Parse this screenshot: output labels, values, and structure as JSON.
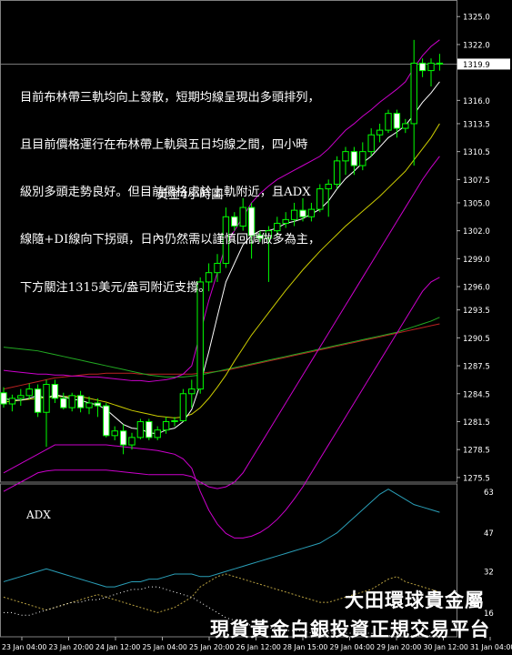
{
  "comment_lines": [
    "目前布林帶三軌均向上發散，短期均線呈現出多頭排列，",
    "且目前價格運行在布林帶上軌與五日均線之間，四小時",
    "級別多頭走勢良好。但目前價格處於上軌附近，且ADX",
    "線隨+DI線向下拐頭，日內仍然需以謹慎回調做多為主，",
    "下方關注1315美元/盎司附近支撐。"
  ],
  "chart_title": "黃金4小時圖",
  "adx_label": "ADX",
  "brand": {
    "line1": "大田環球貴金屬",
    "line2": "現貨黃金白銀投資正規交易平台"
  },
  "colors": {
    "bull_body": "#000000",
    "bear_body": "#ffffff",
    "candle_outline": "#00ff00",
    "bollinger": "#cc00cc",
    "ma_white": "#ffffff",
    "ma_yellow": "#cccc00",
    "ma_green": "#22aa22",
    "ma_red": "#bb2222",
    "adx_line": "#2a9fb8",
    "di_plus": "#b8a040",
    "di_minus": "#ffffff"
  },
  "chart_data": {
    "type": "candlestick",
    "title": "黃金4小時圖",
    "price_axis": {
      "ticks": [
        1325.0,
        1322.0,
        1319.9,
        1316.0,
        1313.5,
        1310.5,
        1307.5,
        1305.0,
        1302.0,
        1299.0,
        1296.0,
        1293.5,
        1290.5,
        1287.5,
        1284.5,
        1281.5,
        1278.5,
        1275.5
      ],
      "current_price_label": "1319.9",
      "range": [
        1275,
        1326
      ]
    },
    "time_axis": {
      "ticks": [
        "23 Jan 04:00",
        "23 Jan 20:00",
        "24 Jan 12:00",
        "25 Jan 04:00",
        "25 Jan 20:00",
        "26 Jan 12:00",
        "28 Jan 15:00",
        "29 Jan 04:00",
        "29 Jan 20:00",
        "30 Jan 12:00",
        "31 Jan 04:00"
      ]
    },
    "candles": [
      {
        "o": 1284.6,
        "h": 1285.2,
        "l": 1283.0,
        "c": 1283.4
      },
      {
        "o": 1283.4,
        "h": 1284.4,
        "l": 1282.6,
        "c": 1284.0
      },
      {
        "o": 1284.0,
        "h": 1285.0,
        "l": 1283.2,
        "c": 1284.3
      },
      {
        "o": 1284.3,
        "h": 1285.6,
        "l": 1283.9,
        "c": 1285.0
      },
      {
        "o": 1285.0,
        "h": 1285.5,
        "l": 1282.0,
        "c": 1282.5
      },
      {
        "o": 1282.5,
        "h": 1286.0,
        "l": 1278.8,
        "c": 1285.5
      },
      {
        "o": 1285.5,
        "h": 1286.0,
        "l": 1283.5,
        "c": 1284.0
      },
      {
        "o": 1284.0,
        "h": 1284.6,
        "l": 1282.8,
        "c": 1283.0
      },
      {
        "o": 1283.0,
        "h": 1284.6,
        "l": 1282.6,
        "c": 1284.3
      },
      {
        "o": 1284.3,
        "h": 1284.8,
        "l": 1282.5,
        "c": 1283.0
      },
      {
        "o": 1283.0,
        "h": 1284.2,
        "l": 1282.3,
        "c": 1283.5
      },
      {
        "o": 1283.5,
        "h": 1284.0,
        "l": 1282.0,
        "c": 1283.2
      },
      {
        "o": 1283.2,
        "h": 1283.5,
        "l": 1279.8,
        "c": 1280.0
      },
      {
        "o": 1280.0,
        "h": 1281.0,
        "l": 1279.5,
        "c": 1280.5
      },
      {
        "o": 1280.5,
        "h": 1281.2,
        "l": 1278.0,
        "c": 1279.0
      },
      {
        "o": 1279.0,
        "h": 1280.3,
        "l": 1278.5,
        "c": 1279.8
      },
      {
        "o": 1279.8,
        "h": 1281.8,
        "l": 1279.6,
        "c": 1281.5
      },
      {
        "o": 1281.5,
        "h": 1281.8,
        "l": 1279.5,
        "c": 1279.8
      },
      {
        "o": 1279.8,
        "h": 1281.0,
        "l": 1279.5,
        "c": 1280.6
      },
      {
        "o": 1280.6,
        "h": 1282.0,
        "l": 1280.2,
        "c": 1281.5
      },
      {
        "o": 1281.5,
        "h": 1282.0,
        "l": 1281.0,
        "c": 1281.6
      },
      {
        "o": 1281.6,
        "h": 1285.0,
        "l": 1281.5,
        "c": 1284.5
      },
      {
        "o": 1284.5,
        "h": 1286.0,
        "l": 1283.0,
        "c": 1285.0
      },
      {
        "o": 1285.0,
        "h": 1297.0,
        "l": 1284.5,
        "c": 1296.5
      },
      {
        "o": 1296.5,
        "h": 1298.5,
        "l": 1295.5,
        "c": 1297.5
      },
      {
        "o": 1297.5,
        "h": 1299.5,
        "l": 1296.5,
        "c": 1298.5
      },
      {
        "o": 1298.5,
        "h": 1304.5,
        "l": 1298.0,
        "c": 1303.5
      },
      {
        "o": 1303.5,
        "h": 1304.0,
        "l": 1302.0,
        "c": 1302.5
      },
      {
        "o": 1302.5,
        "h": 1305.5,
        "l": 1302.0,
        "c": 1304.5
      },
      {
        "o": 1304.5,
        "h": 1305.0,
        "l": 1299.0,
        "c": 1301.5
      },
      {
        "o": 1301.5,
        "h": 1302.0,
        "l": 1300.8,
        "c": 1301.2
      },
      {
        "o": 1301.2,
        "h": 1302.5,
        "l": 1296.5,
        "c": 1302.0
      },
      {
        "o": 1302.0,
        "h": 1303.5,
        "l": 1301.5,
        "c": 1302.8
      },
      {
        "o": 1302.8,
        "h": 1304.0,
        "l": 1302.3,
        "c": 1303.2
      },
      {
        "o": 1303.2,
        "h": 1305.0,
        "l": 1302.5,
        "c": 1304.2
      },
      {
        "o": 1304.2,
        "h": 1305.5,
        "l": 1303.0,
        "c": 1303.5
      },
      {
        "o": 1303.5,
        "h": 1305.0,
        "l": 1303.0,
        "c": 1304.3
      },
      {
        "o": 1304.3,
        "h": 1307.0,
        "l": 1304.0,
        "c": 1306.5
      },
      {
        "o": 1306.5,
        "h": 1307.5,
        "l": 1303.5,
        "c": 1307.0
      },
      {
        "o": 1307.0,
        "h": 1310.0,
        "l": 1306.5,
        "c": 1309.5
      },
      {
        "o": 1309.5,
        "h": 1311.0,
        "l": 1308.0,
        "c": 1310.5
      },
      {
        "o": 1310.5,
        "h": 1311.0,
        "l": 1308.0,
        "c": 1309.0
      },
      {
        "o": 1309.0,
        "h": 1311.5,
        "l": 1308.5,
        "c": 1310.5
      },
      {
        "o": 1310.5,
        "h": 1313.0,
        "l": 1310.0,
        "c": 1312.3
      },
      {
        "o": 1312.3,
        "h": 1313.5,
        "l": 1311.5,
        "c": 1312.8
      },
      {
        "o": 1312.8,
        "h": 1315.0,
        "l": 1312.5,
        "c": 1314.6
      },
      {
        "o": 1314.6,
        "h": 1315.0,
        "l": 1312.0,
        "c": 1313.0
      },
      {
        "o": 1313.0,
        "h": 1314.0,
        "l": 1312.5,
        "c": 1313.5
      },
      {
        "o": 1313.5,
        "h": 1322.5,
        "l": 1309.0,
        "c": 1320.0
      },
      {
        "o": 1320.0,
        "h": 1320.5,
        "l": 1318.5,
        "c": 1319.2
      },
      {
        "o": 1319.2,
        "h": 1320.5,
        "l": 1317.5,
        "c": 1320.0
      },
      {
        "o": 1320.0,
        "h": 1321.0,
        "l": 1319.2,
        "c": 1319.9
      }
    ],
    "ma_white": [
      1284.0,
      1283.8,
      1283.8,
      1284.0,
      1284.3,
      1284.0,
      1284.4,
      1284.2,
      1283.9,
      1283.8,
      1283.5,
      1283.3,
      1282.8,
      1282.0,
      1281.2,
      1280.8,
      1280.7,
      1280.3,
      1280.2,
      1280.6,
      1280.8,
      1281.5,
      1282.8,
      1285.5,
      1289.0,
      1292.8,
      1296.5,
      1298.5,
      1300.5,
      1301.5,
      1302.0,
      1302.0,
      1302.3,
      1302.8,
      1303.0,
      1303.3,
      1303.8,
      1304.3,
      1305.2,
      1306.5,
      1307.6,
      1308.4,
      1309.3,
      1310.0,
      1311.0,
      1312.0,
      1312.6,
      1313.3,
      1314.5,
      1315.8,
      1316.8,
      1318.0
    ],
    "ma_yellow": [
      1283.6,
      1283.7,
      1283.8,
      1283.9,
      1284.0,
      1284.1,
      1284.2,
      1284.2,
      1284.2,
      1284.2,
      1284.0,
      1283.8,
      1283.6,
      1283.3,
      1283.0,
      1282.7,
      1282.5,
      1282.3,
      1282.1,
      1282.0,
      1281.9,
      1282.0,
      1282.3,
      1283.0,
      1284.0,
      1285.2,
      1286.5,
      1288.0,
      1289.4,
      1290.8,
      1292.0,
      1293.2,
      1294.4,
      1295.6,
      1296.7,
      1297.8,
      1298.8,
      1299.8,
      1300.7,
      1301.6,
      1302.5,
      1303.3,
      1304.1,
      1304.9,
      1305.7,
      1306.6,
      1307.5,
      1308.4,
      1309.6,
      1310.8,
      1312.0,
      1313.5
    ],
    "ma_green": [
      1289.5,
      1289.4,
      1289.3,
      1289.2,
      1289.1,
      1288.9,
      1288.7,
      1288.5,
      1288.3,
      1288.1,
      1287.9,
      1287.7,
      1287.5,
      1287.3,
      1287.1,
      1286.9,
      1286.7,
      1286.5,
      1286.4,
      1286.3,
      1286.3,
      1286.3,
      1286.4,
      1286.5,
      1286.7,
      1286.9,
      1287.1,
      1287.3,
      1287.5,
      1287.7,
      1287.9,
      1288.1,
      1288.3,
      1288.5,
      1288.7,
      1288.9,
      1289.1,
      1289.3,
      1289.5,
      1289.7,
      1289.9,
      1290.1,
      1290.3,
      1290.5,
      1290.7,
      1290.9,
      1291.1,
      1291.4,
      1291.7,
      1292.0,
      1292.3,
      1292.7
    ],
    "ma_red": [
      1285.0,
      1285.2,
      1285.4,
      1285.6,
      1285.8,
      1286.0,
      1286.2,
      1286.3,
      1286.4,
      1286.5,
      1286.6,
      1286.6,
      1286.7,
      1286.7,
      1286.7,
      1286.7,
      1286.6,
      1286.6,
      1286.6,
      1286.6,
      1286.6,
      1286.6,
      1286.6,
      1286.7,
      1286.8,
      1286.9,
      1287.0,
      1287.2,
      1287.4,
      1287.6,
      1287.8,
      1288.0,
      1288.2,
      1288.4,
      1288.6,
      1288.8,
      1289.0,
      1289.2,
      1289.4,
      1289.6,
      1289.8,
      1290.0,
      1290.2,
      1290.4,
      1290.6,
      1290.8,
      1291.0,
      1291.2,
      1291.4,
      1291.6,
      1291.8,
      1292.0
    ],
    "boll_upper": [
      1287.0,
      1286.9,
      1286.8,
      1286.7,
      1286.6,
      1286.6,
      1286.5,
      1286.5,
      1286.4,
      1286.4,
      1286.3,
      1286.3,
      1286.2,
      1286.1,
      1286.0,
      1285.9,
      1285.9,
      1285.8,
      1285.9,
      1286.0,
      1286.2,
      1286.6,
      1287.5,
      1291.0,
      1294.5,
      1297.5,
      1300.5,
      1302.0,
      1303.5,
      1305.0,
      1306.0,
      1306.8,
      1307.5,
      1308.0,
      1308.5,
      1309.0,
      1309.5,
      1310.0,
      1310.8,
      1311.8,
      1312.8,
      1313.5,
      1314.3,
      1315.0,
      1315.8,
      1316.5,
      1317.2,
      1318.0,
      1319.5,
      1320.8,
      1321.8,
      1322.5
    ],
    "boll_lower": [
      1276.0,
      1276.5,
      1277.0,
      1277.5,
      1278.0,
      1278.5,
      1279.0,
      1279.0,
      1279.0,
      1279.0,
      1279.0,
      1279.0,
      1279.0,
      1278.9,
      1278.8,
      1278.7,
      1278.6,
      1278.5,
      1278.4,
      1278.2,
      1278.0,
      1277.5,
      1276.5,
      1274.0,
      1272.0,
      1270.5,
      1269.5,
      1269.0,
      1269.0,
      1269.2,
      1269.6,
      1270.2,
      1271.0,
      1272.0,
      1273.2,
      1274.5,
      1276.0,
      1277.5,
      1279.0,
      1280.5,
      1282.0,
      1283.5,
      1285.0,
      1286.5,
      1288.0,
      1289.5,
      1291.0,
      1292.5,
      1294.0,
      1295.5,
      1296.5,
      1297.0
    ],
    "boll_lower2": [
      1274.0,
      1274.5,
      1275.0,
      1275.5,
      1276.0,
      1276.2,
      1276.3,
      1276.3,
      1276.3,
      1276.3,
      1276.3,
      1276.3,
      1276.3,
      1276.2,
      1276.1,
      1276.0,
      1275.9,
      1275.8,
      1275.8,
      1275.8,
      1275.8,
      1275.8,
      1275.6,
      1275.0,
      1274.5,
      1274.3,
      1274.5,
      1275.0,
      1276.0,
      1277.5,
      1279.0,
      1280.5,
      1282.0,
      1283.5,
      1285.0,
      1286.5,
      1288.0,
      1289.5,
      1291.0,
      1292.5,
      1294.0,
      1295.5,
      1297.0,
      1298.5,
      1300.0,
      1301.5,
      1303.0,
      1304.5,
      1306.0,
      1307.5,
      1308.8,
      1310.0
    ],
    "adx": {
      "axis_ticks": [
        63,
        47,
        32,
        16
      ],
      "adx_line": [
        28,
        29,
        30,
        31,
        32,
        33,
        32,
        31,
        30,
        29,
        28,
        27,
        26,
        26,
        27,
        28,
        28,
        29,
        29,
        30,
        31,
        31,
        31,
        30,
        30,
        31,
        32,
        33,
        34,
        35,
        36,
        37,
        38,
        39,
        40,
        41,
        42,
        43,
        45,
        47,
        50,
        53,
        56,
        59,
        62,
        64,
        62,
        60,
        58,
        57,
        56,
        55
      ],
      "di_plus": [
        22,
        21,
        20,
        19,
        18,
        17,
        18,
        19,
        20,
        21,
        22,
        23,
        22,
        21,
        20,
        19,
        18,
        17,
        16,
        17,
        18,
        20,
        22,
        26,
        28,
        30,
        31,
        30,
        29,
        28,
        27,
        26,
        25,
        24,
        23,
        22,
        21,
        20,
        20,
        21,
        22,
        23,
        24,
        25,
        27,
        29,
        30,
        28,
        27,
        26,
        25,
        24
      ],
      "di_minus": [
        16,
        16,
        15,
        15,
        16,
        17,
        18,
        19,
        20,
        20,
        21,
        21,
        22,
        23,
        24,
        25,
        25,
        26,
        26,
        25,
        24,
        23,
        22,
        20,
        18,
        16,
        14,
        13,
        12,
        11,
        10,
        10,
        10,
        9,
        9,
        9,
        8,
        8,
        8,
        8,
        8,
        8,
        8,
        8,
        7,
        7,
        7,
        7,
        7,
        7,
        7,
        7
      ]
    }
  }
}
